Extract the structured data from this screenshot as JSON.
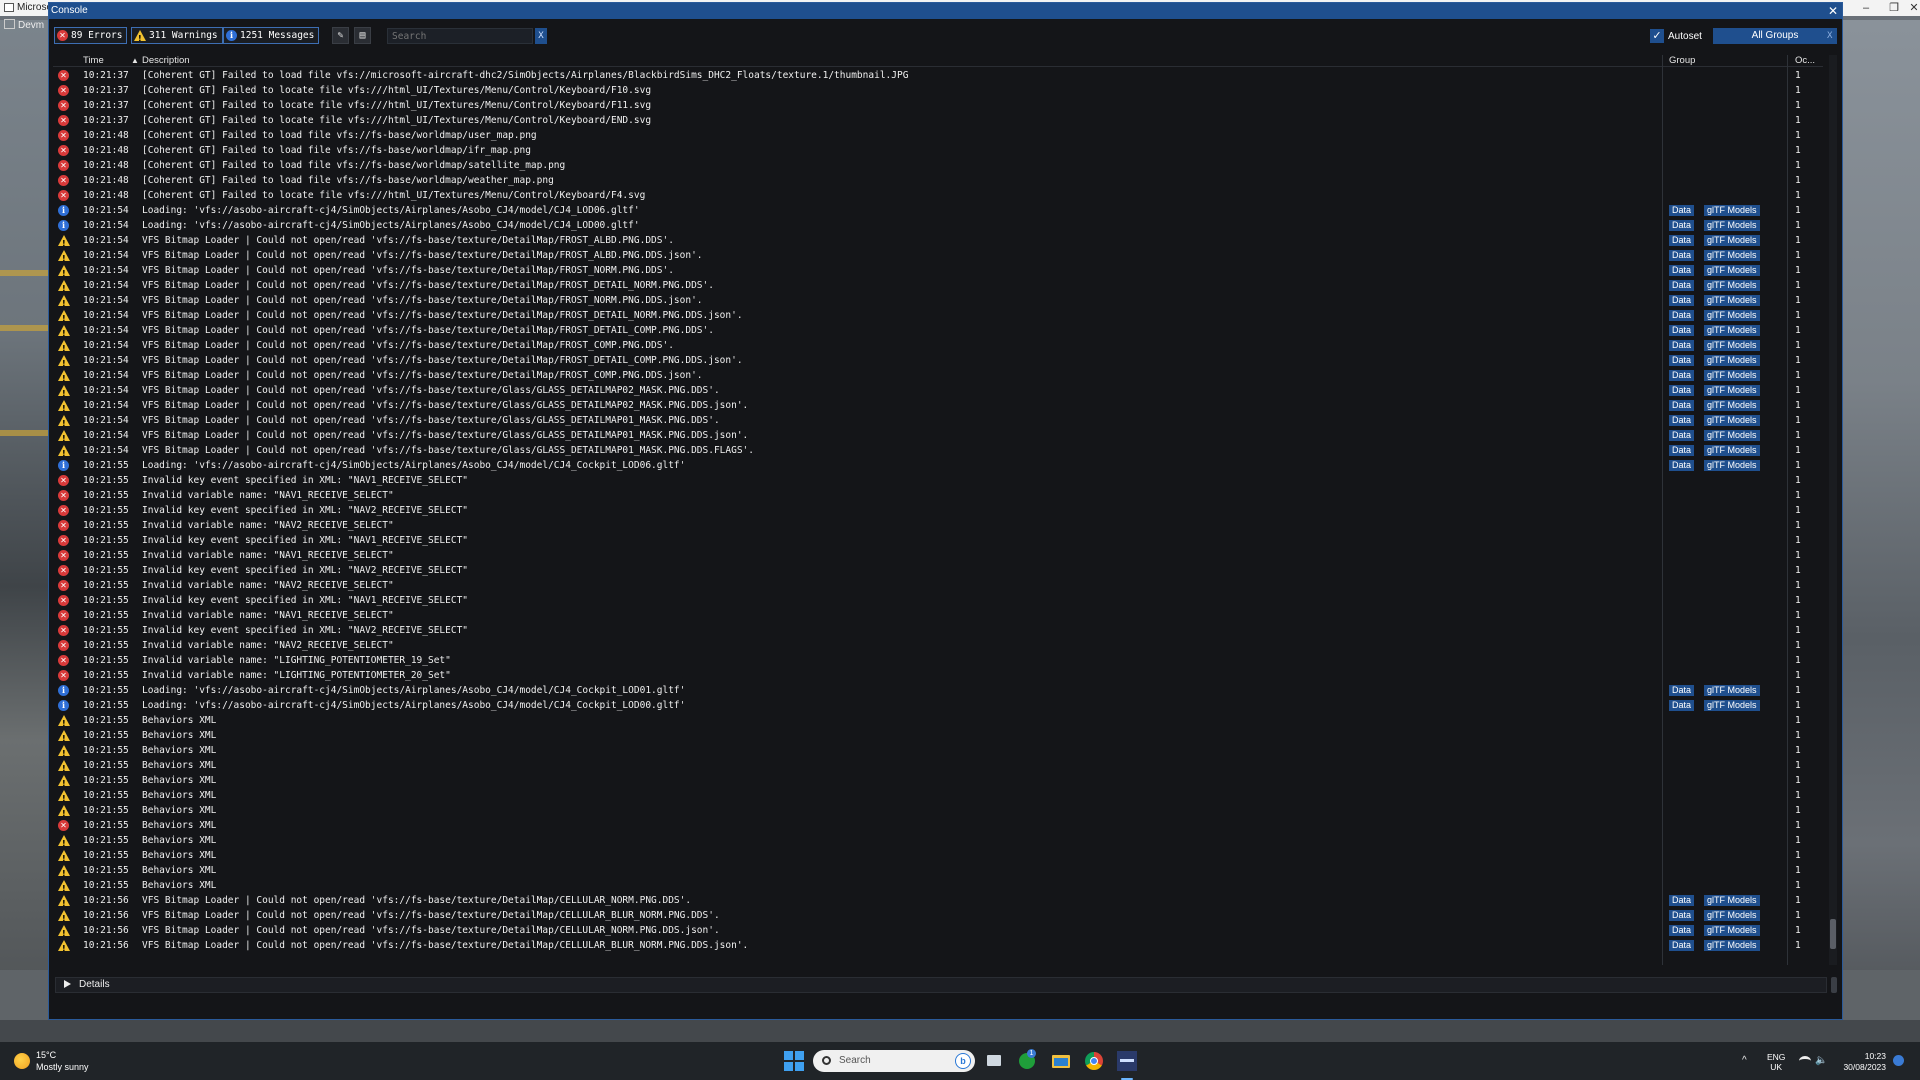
{
  "app": {
    "title": "Microso",
    "devmode_label": "Devm"
  },
  "console": {
    "title": "Console",
    "close_glyph": "✕",
    "filters": {
      "errors": "89 Errors",
      "warnings": "311 Warnings",
      "messages": "1251 Messages"
    },
    "search": {
      "placeholder": "Search",
      "clear_glyph": "X"
    },
    "autoset": {
      "label": "Autoset",
      "checked": true
    },
    "groups": {
      "selected": "All Groups",
      "clear_glyph": "X"
    },
    "columns": {
      "time": "Time",
      "description": "Description",
      "group": "Group",
      "count": "Oc..."
    },
    "details_label": "Details"
  },
  "rows": [
    {
      "sev": "error",
      "time": "10:21:37",
      "desc": "[Coherent GT] Failed to load file vfs://microsoft-aircraft-dhc2/SimObjects/Airplanes/BlackbirdSims_DHC2_Floats/texture.1/thumbnail.JPG",
      "tags": [],
      "count": "1"
    },
    {
      "sev": "error",
      "time": "10:21:37",
      "desc": "[Coherent GT] Failed to locate file vfs:///html_UI/Textures/Menu/Control/Keyboard/F10.svg",
      "tags": [],
      "count": "1"
    },
    {
      "sev": "error",
      "time": "10:21:37",
      "desc": "[Coherent GT] Failed to locate file vfs:///html_UI/Textures/Menu/Control/Keyboard/F11.svg",
      "tags": [],
      "count": "1"
    },
    {
      "sev": "error",
      "time": "10:21:37",
      "desc": "[Coherent GT] Failed to locate file vfs:///html_UI/Textures/Menu/Control/Keyboard/END.svg",
      "tags": [],
      "count": "1"
    },
    {
      "sev": "error",
      "time": "10:21:48",
      "desc": "[Coherent GT] Failed to load file vfs://fs-base/worldmap/user_map.png",
      "tags": [],
      "count": "1"
    },
    {
      "sev": "error",
      "time": "10:21:48",
      "desc": "[Coherent GT] Failed to load file vfs://fs-base/worldmap/ifr_map.png",
      "tags": [],
      "count": "1"
    },
    {
      "sev": "error",
      "time": "10:21:48",
      "desc": "[Coherent GT] Failed to load file vfs://fs-base/worldmap/satellite_map.png",
      "tags": [],
      "count": "1"
    },
    {
      "sev": "error",
      "time": "10:21:48",
      "desc": "[Coherent GT] Failed to load file vfs://fs-base/worldmap/weather_map.png",
      "tags": [],
      "count": "1"
    },
    {
      "sev": "error",
      "time": "10:21:48",
      "desc": "[Coherent GT] Failed to locate file vfs:///html_UI/Textures/Menu/Control/Keyboard/F4.svg",
      "tags": [],
      "count": "1"
    },
    {
      "sev": "info",
      "time": "10:21:54",
      "desc": "Loading: 'vfs://asobo-aircraft-cj4/SimObjects/Airplanes/Asobo_CJ4/model/CJ4_LOD06.gltf'",
      "tags": [
        "Data",
        "glTF Models"
      ],
      "count": "1"
    },
    {
      "sev": "info",
      "time": "10:21:54",
      "desc": "Loading: 'vfs://asobo-aircraft-cj4/SimObjects/Airplanes/Asobo_CJ4/model/CJ4_LOD00.gltf'",
      "tags": [
        "Data",
        "glTF Models"
      ],
      "count": "1"
    },
    {
      "sev": "warn",
      "time": "10:21:54",
      "desc": "VFS Bitmap Loader | Could not open/read 'vfs://fs-base/texture/DetailMap/FROST_ALBD.PNG.DDS'.",
      "tags": [
        "Data",
        "glTF Models"
      ],
      "count": "1"
    },
    {
      "sev": "warn",
      "time": "10:21:54",
      "desc": "VFS Bitmap Loader | Could not open/read 'vfs://fs-base/texture/DetailMap/FROST_ALBD.PNG.DDS.json'.",
      "tags": [
        "Data",
        "glTF Models"
      ],
      "count": "1"
    },
    {
      "sev": "warn",
      "time": "10:21:54",
      "desc": "VFS Bitmap Loader | Could not open/read 'vfs://fs-base/texture/DetailMap/FROST_NORM.PNG.DDS'.",
      "tags": [
        "Data",
        "glTF Models"
      ],
      "count": "1"
    },
    {
      "sev": "warn",
      "time": "10:21:54",
      "desc": "VFS Bitmap Loader | Could not open/read 'vfs://fs-base/texture/DetailMap/FROST_DETAIL_NORM.PNG.DDS'.",
      "tags": [
        "Data",
        "glTF Models"
      ],
      "count": "1"
    },
    {
      "sev": "warn",
      "time": "10:21:54",
      "desc": "VFS Bitmap Loader | Could not open/read 'vfs://fs-base/texture/DetailMap/FROST_NORM.PNG.DDS.json'.",
      "tags": [
        "Data",
        "glTF Models"
      ],
      "count": "1"
    },
    {
      "sev": "warn",
      "time": "10:21:54",
      "desc": "VFS Bitmap Loader | Could not open/read 'vfs://fs-base/texture/DetailMap/FROST_DETAIL_NORM.PNG.DDS.json'.",
      "tags": [
        "Data",
        "glTF Models"
      ],
      "count": "1"
    },
    {
      "sev": "warn",
      "time": "10:21:54",
      "desc": "VFS Bitmap Loader | Could not open/read 'vfs://fs-base/texture/DetailMap/FROST_DETAIL_COMP.PNG.DDS'.",
      "tags": [
        "Data",
        "glTF Models"
      ],
      "count": "1"
    },
    {
      "sev": "warn",
      "time": "10:21:54",
      "desc": "VFS Bitmap Loader | Could not open/read 'vfs://fs-base/texture/DetailMap/FROST_COMP.PNG.DDS'.",
      "tags": [
        "Data",
        "glTF Models"
      ],
      "count": "1"
    },
    {
      "sev": "warn",
      "time": "10:21:54",
      "desc": "VFS Bitmap Loader | Could not open/read 'vfs://fs-base/texture/DetailMap/FROST_DETAIL_COMP.PNG.DDS.json'.",
      "tags": [
        "Data",
        "glTF Models"
      ],
      "count": "1"
    },
    {
      "sev": "warn",
      "time": "10:21:54",
      "desc": "VFS Bitmap Loader | Could not open/read 'vfs://fs-base/texture/DetailMap/FROST_COMP.PNG.DDS.json'.",
      "tags": [
        "Data",
        "glTF Models"
      ],
      "count": "1"
    },
    {
      "sev": "warn",
      "time": "10:21:54",
      "desc": "VFS Bitmap Loader | Could not open/read 'vfs://fs-base/texture/Glass/GLASS_DETAILMAP02_MASK.PNG.DDS'.",
      "tags": [
        "Data",
        "glTF Models"
      ],
      "count": "1"
    },
    {
      "sev": "warn",
      "time": "10:21:54",
      "desc": "VFS Bitmap Loader | Could not open/read 'vfs://fs-base/texture/Glass/GLASS_DETAILMAP02_MASK.PNG.DDS.json'.",
      "tags": [
        "Data",
        "glTF Models"
      ],
      "count": "1"
    },
    {
      "sev": "warn",
      "time": "10:21:54",
      "desc": "VFS Bitmap Loader | Could not open/read 'vfs://fs-base/texture/Glass/GLASS_DETAILMAP01_MASK.PNG.DDS'.",
      "tags": [
        "Data",
        "glTF Models"
      ],
      "count": "1"
    },
    {
      "sev": "warn",
      "time": "10:21:54",
      "desc": "VFS Bitmap Loader | Could not open/read 'vfs://fs-base/texture/Glass/GLASS_DETAILMAP01_MASK.PNG.DDS.json'.",
      "tags": [
        "Data",
        "glTF Models"
      ],
      "count": "1"
    },
    {
      "sev": "warn",
      "time": "10:21:54",
      "desc": "VFS Bitmap Loader | Could not open/read 'vfs://fs-base/texture/Glass/GLASS_DETAILMAP01_MASK.PNG.DDS.FLAGS'.",
      "tags": [
        "Data",
        "glTF Models"
      ],
      "count": "1"
    },
    {
      "sev": "info",
      "time": "10:21:55",
      "desc": "Loading: 'vfs://asobo-aircraft-cj4/SimObjects/Airplanes/Asobo_CJ4/model/CJ4_Cockpit_LOD06.gltf'",
      "tags": [
        "Data",
        "glTF Models"
      ],
      "count": "1"
    },
    {
      "sev": "error",
      "time": "10:21:55",
      "desc": "Invalid key event specified in XML: \"NAV1_RECEIVE_SELECT\"",
      "tags": [],
      "count": "1"
    },
    {
      "sev": "error",
      "time": "10:21:55",
      "desc": "Invalid variable name: \"NAV1_RECEIVE_SELECT\"",
      "tags": [],
      "count": "1"
    },
    {
      "sev": "error",
      "time": "10:21:55",
      "desc": "Invalid key event specified in XML: \"NAV2_RECEIVE_SELECT\"",
      "tags": [],
      "count": "1"
    },
    {
      "sev": "error",
      "time": "10:21:55",
      "desc": "Invalid variable name: \"NAV2_RECEIVE_SELECT\"",
      "tags": [],
      "count": "1"
    },
    {
      "sev": "error",
      "time": "10:21:55",
      "desc": "Invalid key event specified in XML: \"NAV1_RECEIVE_SELECT\"",
      "tags": [],
      "count": "1"
    },
    {
      "sev": "error",
      "time": "10:21:55",
      "desc": "Invalid variable name: \"NAV1_RECEIVE_SELECT\"",
      "tags": [],
      "count": "1"
    },
    {
      "sev": "error",
      "time": "10:21:55",
      "desc": "Invalid key event specified in XML: \"NAV2_RECEIVE_SELECT\"",
      "tags": [],
      "count": "1"
    },
    {
      "sev": "error",
      "time": "10:21:55",
      "desc": "Invalid variable name: \"NAV2_RECEIVE_SELECT\"",
      "tags": [],
      "count": "1"
    },
    {
      "sev": "error",
      "time": "10:21:55",
      "desc": "Invalid key event specified in XML: \"NAV1_RECEIVE_SELECT\"",
      "tags": [],
      "count": "1"
    },
    {
      "sev": "error",
      "time": "10:21:55",
      "desc": "Invalid variable name: \"NAV1_RECEIVE_SELECT\"",
      "tags": [],
      "count": "1"
    },
    {
      "sev": "error",
      "time": "10:21:55",
      "desc": "Invalid key event specified in XML: \"NAV2_RECEIVE_SELECT\"",
      "tags": [],
      "count": "1"
    },
    {
      "sev": "error",
      "time": "10:21:55",
      "desc": "Invalid variable name: \"NAV2_RECEIVE_SELECT\"",
      "tags": [],
      "count": "1"
    },
    {
      "sev": "error",
      "time": "10:21:55",
      "desc": "Invalid variable name: \"LIGHTING_POTENTIOMETER_19_Set\"",
      "tags": [],
      "count": "1"
    },
    {
      "sev": "error",
      "time": "10:21:55",
      "desc": "Invalid variable name: \"LIGHTING_POTENTIOMETER_20_Set\"",
      "tags": [],
      "count": "1"
    },
    {
      "sev": "info",
      "time": "10:21:55",
      "desc": "Loading: 'vfs://asobo-aircraft-cj4/SimObjects/Airplanes/Asobo_CJ4/model/CJ4_Cockpit_LOD01.gltf'",
      "tags": [
        "Data",
        "glTF Models"
      ],
      "count": "1"
    },
    {
      "sev": "info",
      "time": "10:21:55",
      "desc": "Loading: 'vfs://asobo-aircraft-cj4/SimObjects/Airplanes/Asobo_CJ4/model/CJ4_Cockpit_LOD00.gltf'",
      "tags": [
        "Data",
        "glTF Models"
      ],
      "count": "1"
    },
    {
      "sev": "warn",
      "time": "10:21:55",
      "desc": "Behaviors XML",
      "tags": [],
      "count": "1"
    },
    {
      "sev": "warn",
      "time": "10:21:55",
      "desc": "Behaviors XML",
      "tags": [],
      "count": "1"
    },
    {
      "sev": "warn",
      "time": "10:21:55",
      "desc": "Behaviors XML",
      "tags": [],
      "count": "1"
    },
    {
      "sev": "warn",
      "time": "10:21:55",
      "desc": "Behaviors XML",
      "tags": [],
      "count": "1"
    },
    {
      "sev": "warn",
      "time": "10:21:55",
      "desc": "Behaviors XML",
      "tags": [],
      "count": "1"
    },
    {
      "sev": "warn",
      "time": "10:21:55",
      "desc": "Behaviors XML",
      "tags": [],
      "count": "1"
    },
    {
      "sev": "warn",
      "time": "10:21:55",
      "desc": "Behaviors XML",
      "tags": [],
      "count": "1"
    },
    {
      "sev": "error",
      "time": "10:21:55",
      "desc": "Behaviors XML",
      "tags": [],
      "count": "1"
    },
    {
      "sev": "warn",
      "time": "10:21:55",
      "desc": "Behaviors XML",
      "tags": [],
      "count": "1"
    },
    {
      "sev": "warn",
      "time": "10:21:55",
      "desc": "Behaviors XML",
      "tags": [],
      "count": "1"
    },
    {
      "sev": "warn",
      "time": "10:21:55",
      "desc": "Behaviors XML",
      "tags": [],
      "count": "1"
    },
    {
      "sev": "warn",
      "time": "10:21:55",
      "desc": "Behaviors XML",
      "tags": [],
      "count": "1"
    },
    {
      "sev": "warn",
      "time": "10:21:56",
      "desc": "VFS Bitmap Loader | Could not open/read 'vfs://fs-base/texture/DetailMap/CELLULAR_NORM.PNG.DDS'.",
      "tags": [
        "Data",
        "glTF Models"
      ],
      "count": "1"
    },
    {
      "sev": "warn",
      "time": "10:21:56",
      "desc": "VFS Bitmap Loader | Could not open/read 'vfs://fs-base/texture/DetailMap/CELLULAR_BLUR_NORM.PNG.DDS'.",
      "tags": [
        "Data",
        "glTF Models"
      ],
      "count": "1"
    },
    {
      "sev": "warn",
      "time": "10:21:56",
      "desc": "VFS Bitmap Loader | Could not open/read 'vfs://fs-base/texture/DetailMap/CELLULAR_NORM.PNG.DDS.json'.",
      "tags": [
        "Data",
        "glTF Models"
      ],
      "count": "1"
    },
    {
      "sev": "warn",
      "time": "10:21:56",
      "desc": "VFS Bitmap Loader | Could not open/read 'vfs://fs-base/texture/DetailMap/CELLULAR_BLUR_NORM.PNG.DDS.json'.",
      "tags": [
        "Data",
        "glTF Models"
      ],
      "count": "1"
    }
  ],
  "taskbar": {
    "weather": {
      "temp": "15°C",
      "condition": "Mostly sunny"
    },
    "search_placeholder": "Search",
    "search_bing_glyph": "b",
    "xbox_badge": "1",
    "tray_chevron": "^",
    "volume_glyph": "🔈",
    "lang": {
      "line1": "ENG",
      "line2": "UK"
    },
    "clock": {
      "time": "10:23",
      "date": "30/08/2023"
    }
  },
  "colors": {
    "accent": "#1f4f8e",
    "error": "#d83a3a",
    "warning": "#f2c230",
    "info": "#2f6fd6"
  }
}
